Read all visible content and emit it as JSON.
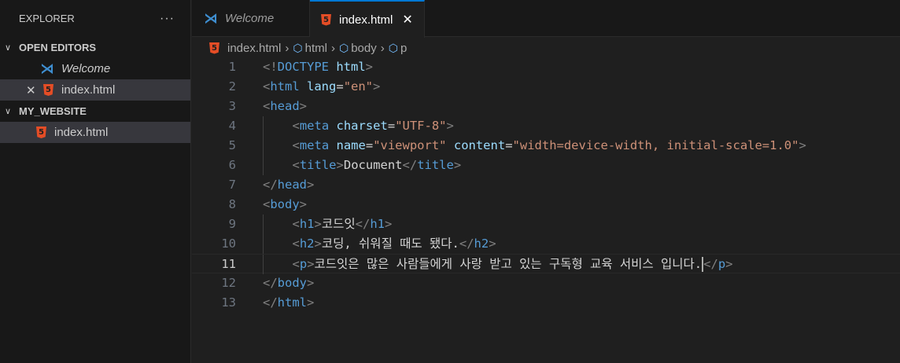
{
  "sidebar": {
    "title": "EXPLORER",
    "more": "···",
    "open_editors": "OPEN EDITORS",
    "project": "MY_WEBSITE",
    "open_items": [
      {
        "label": "Welcome"
      },
      {
        "label": "index.html"
      }
    ],
    "files": [
      {
        "label": "index.html"
      }
    ]
  },
  "tabs": [
    {
      "label": "Welcome"
    },
    {
      "label": "index.html"
    }
  ],
  "breadcrumb": [
    "index.html",
    "html",
    "body",
    "p"
  ],
  "colors": {
    "tag": "#569cd6",
    "attr": "#9cdcfe",
    "string": "#ce9178",
    "bracket": "#808080",
    "accent": "#0078d4"
  },
  "current_line": 11,
  "code": [
    {
      "n": "1",
      "indent": 0,
      "t": [
        [
          "b",
          "<!"
        ],
        [
          "n",
          "DOCTYPE"
        ],
        [
          "x",
          " "
        ],
        [
          "a",
          "html"
        ],
        [
          "b",
          ">"
        ]
      ]
    },
    {
      "n": "2",
      "indent": 0,
      "t": [
        [
          "b",
          "<"
        ],
        [
          "n",
          "html"
        ],
        [
          "x",
          " "
        ],
        [
          "a",
          "lang"
        ],
        [
          "x",
          "="
        ],
        [
          "s",
          "\"en\""
        ],
        [
          "b",
          ">"
        ]
      ]
    },
    {
      "n": "3",
      "indent": 0,
      "t": [
        [
          "b",
          "<"
        ],
        [
          "n",
          "head"
        ],
        [
          "b",
          ">"
        ]
      ]
    },
    {
      "n": "4",
      "indent": 1,
      "t": [
        [
          "b",
          "<"
        ],
        [
          "n",
          "meta"
        ],
        [
          "x",
          " "
        ],
        [
          "a",
          "charset"
        ],
        [
          "x",
          "="
        ],
        [
          "s",
          "\"UTF-8\""
        ],
        [
          "b",
          ">"
        ]
      ]
    },
    {
      "n": "5",
      "indent": 1,
      "t": [
        [
          "b",
          "<"
        ],
        [
          "n",
          "meta"
        ],
        [
          "x",
          " "
        ],
        [
          "a",
          "name"
        ],
        [
          "x",
          "="
        ],
        [
          "s",
          "\"viewport\""
        ],
        [
          "x",
          " "
        ],
        [
          "a",
          "content"
        ],
        [
          "x",
          "="
        ],
        [
          "s",
          "\"width=device-width, initial-scale=1.0\""
        ],
        [
          "b",
          ">"
        ]
      ]
    },
    {
      "n": "6",
      "indent": 1,
      "t": [
        [
          "b",
          "<"
        ],
        [
          "n",
          "title"
        ],
        [
          "b",
          ">"
        ],
        [
          "x",
          "Document"
        ],
        [
          "b",
          "</"
        ],
        [
          "n",
          "title"
        ],
        [
          "b",
          ">"
        ]
      ]
    },
    {
      "n": "7",
      "indent": 0,
      "t": [
        [
          "b",
          "</"
        ],
        [
          "n",
          "head"
        ],
        [
          "b",
          ">"
        ]
      ]
    },
    {
      "n": "8",
      "indent": 0,
      "t": [
        [
          "b",
          "<"
        ],
        [
          "n",
          "body"
        ],
        [
          "b",
          ">"
        ]
      ]
    },
    {
      "n": "9",
      "indent": 1,
      "t": [
        [
          "b",
          "<"
        ],
        [
          "n",
          "h1"
        ],
        [
          "b",
          ">"
        ],
        [
          "x",
          "코드잇"
        ],
        [
          "b",
          "</"
        ],
        [
          "n",
          "h1"
        ],
        [
          "b",
          ">"
        ]
      ]
    },
    {
      "n": "10",
      "indent": 1,
      "t": [
        [
          "b",
          "<"
        ],
        [
          "n",
          "h2"
        ],
        [
          "b",
          ">"
        ],
        [
          "x",
          "코딩, 쉬워질 때도 됐다."
        ],
        [
          "b",
          "</"
        ],
        [
          "n",
          "h2"
        ],
        [
          "b",
          ">"
        ]
      ]
    },
    {
      "n": "11",
      "indent": 1,
      "t": [
        [
          "b",
          "<"
        ],
        [
          "n",
          "p"
        ],
        [
          "b",
          ">"
        ],
        [
          "x",
          "코드잇은 많은 사람들에게 사랑 받고 있는 구독형 교육 서비스 입니다."
        ],
        [
          "c",
          ""
        ],
        [
          "b",
          "</"
        ],
        [
          "n",
          "p"
        ],
        [
          "b",
          ">"
        ]
      ]
    },
    {
      "n": "12",
      "indent": 0,
      "t": [
        [
          "b",
          "</"
        ],
        [
          "n",
          "body"
        ],
        [
          "b",
          ">"
        ]
      ]
    },
    {
      "n": "13",
      "indent": 0,
      "t": [
        [
          "b",
          "</"
        ],
        [
          "n",
          "html"
        ],
        [
          "b",
          ">"
        ]
      ]
    }
  ]
}
